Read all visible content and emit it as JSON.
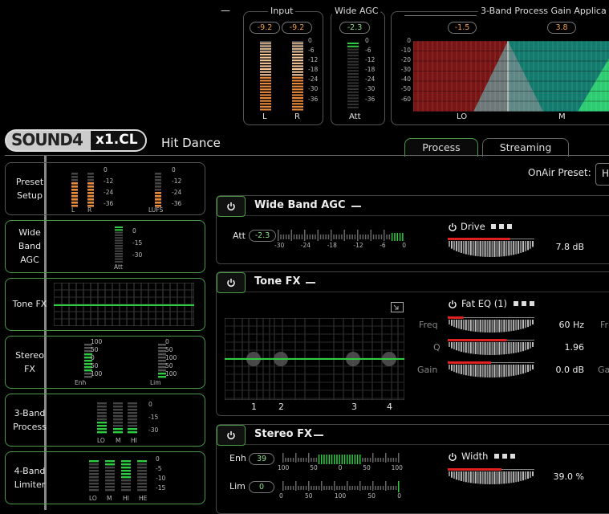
{
  "header": {
    "logo_sound": "SOUND4",
    "logo_model": "x1.CL",
    "preset_name": "Hit Dance",
    "dash": "—"
  },
  "meters": {
    "input": {
      "title": "Input",
      "left_value": "-9.2",
      "right_value": "-9.2",
      "scale": [
        "0",
        "-6",
        "-12",
        "-18",
        "-24",
        "-30",
        "-36"
      ],
      "left_label": "L",
      "right_label": "R"
    },
    "wide_agc": {
      "title": "Wide AGC",
      "value": "-2.3",
      "scale": [
        "0",
        "-6",
        "-12",
        "-18",
        "-24",
        "-30",
        "-36"
      ],
      "label": "Att"
    },
    "three_band": {
      "title": "3-Band Process Gain Applica",
      "lo_value": "-1.5",
      "m_value": "3.8",
      "scale": [
        "0",
        "-10",
        "-20",
        "-30",
        "-40",
        "-50",
        "-60"
      ],
      "lo_label": "LO",
      "m_label": "M"
    }
  },
  "tabs": {
    "process": "Process",
    "streaming": "Streaming"
  },
  "onair": {
    "label": "OnAir Preset:",
    "value": "H"
  },
  "sidebar": {
    "preset_setup": {
      "label_1": "Preset",
      "label_2": "Setup",
      "scale": [
        "0",
        "-12",
        "-24",
        "-36"
      ],
      "l": "L",
      "r": "R",
      "lufs": "LUFS"
    },
    "wide_band_agc": {
      "label_1": "Wide",
      "label_2": "Band",
      "label_3": "AGC",
      "scale": [
        "0",
        "-15",
        "-30"
      ],
      "att": "Att"
    },
    "tone_fx": {
      "label": "Tone FX"
    },
    "stereo_fx": {
      "label_1": "Stereo",
      "label_2": "FX",
      "scale": [
        "100",
        "50",
        "0",
        "50",
        "100"
      ],
      "scale_right": [
        "0",
        "50",
        "100",
        "50",
        "100"
      ],
      "enh": "Enh",
      "lim": "Lim"
    },
    "three_band_process": {
      "label_1": "3-Band",
      "label_2": "Process",
      "scale": [
        "0",
        "-15",
        "-30"
      ],
      "lo": "LO",
      "m": "M",
      "hi": "HI"
    },
    "four_band_limiter": {
      "label_1": "4-Band",
      "label_2": "Limiter",
      "scale": [
        "0",
        "-5",
        "-10",
        "-15"
      ],
      "lo": "LO",
      "m": "M",
      "hi": "HI",
      "he": "HE"
    }
  },
  "wide_band_agc": {
    "title": "Wide Band AGC",
    "att_label": "Att",
    "att_value": "-2.3",
    "scale": [
      "-30",
      "-24",
      "-18",
      "-12",
      "-6",
      "0"
    ],
    "drive_label": "Drive",
    "drive_value": "7.8 dB",
    "drive_level": 0.72
  },
  "tone_fx": {
    "title": "Tone FX",
    "band_labels": [
      "1",
      "2",
      "3",
      "4"
    ],
    "fat_eq_label": "Fat EQ (1)",
    "freq_label": "Freq",
    "freq_value": "60 Hz",
    "freq_level": 0.18,
    "q_label": "Q",
    "q_value": "1.96",
    "q_level": 0.68,
    "gain_label": "Gain",
    "gain_value": "0.0 dB",
    "gain_level": 0.5,
    "right_freq_label": "Fr",
    "right_gain_label": "Ga"
  },
  "stereo_fx": {
    "title": "Stereo FX",
    "enh_label": "Enh",
    "enh_value": "39",
    "enh_scale": [
      "100",
      "50",
      "0",
      "50",
      "100"
    ],
    "lim_label": "Lim",
    "lim_value": "0",
    "lim_scale": [
      "0",
      "50",
      "100",
      "50",
      "0"
    ],
    "width_label": "Width",
    "width_value": "39.0 %",
    "width_level": 0.62
  },
  "colors": {
    "accent_green": "#2ecc40",
    "meter_orange": "#f0a060",
    "lo_red": "#8b1a1a",
    "m_teal": "#1a8a7a",
    "power_border": "#4a9a4a"
  }
}
